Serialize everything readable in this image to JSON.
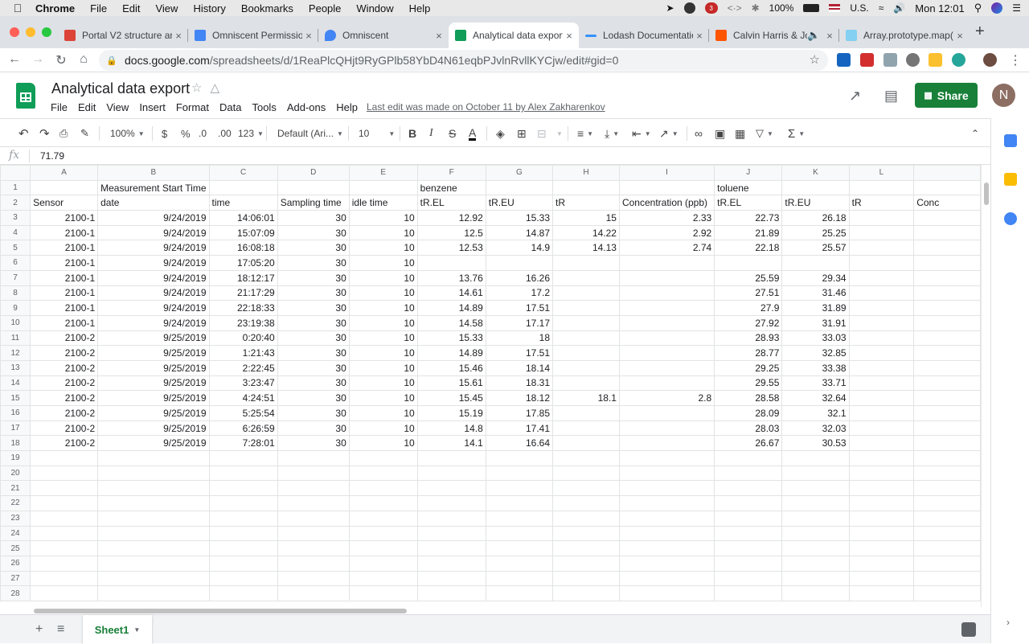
{
  "menubar": {
    "app": "Chrome",
    "items": [
      "File",
      "Edit",
      "View",
      "History",
      "Bookmarks",
      "People",
      "Window",
      "Help"
    ],
    "battery": "100%",
    "input_source": "U.S.",
    "clock": "Mon 12:01",
    "badge_count": "3"
  },
  "tabs": [
    {
      "title": "Portal V2 structure an",
      "color": "#db4437"
    },
    {
      "title": "Omniscent Permission",
      "color": "#4285f4"
    },
    {
      "title": "Omniscent",
      "color": "#4285f4"
    },
    {
      "title": "Analytical data export",
      "color": "#0f9d58"
    },
    {
      "title": "Lodash Documentation",
      "color": "#3492ff"
    },
    {
      "title": "Calvin Harris & Jo",
      "color": "#ff5500"
    },
    {
      "title": "Array.prototype.map(",
      "color": "#83d0f2"
    }
  ],
  "address": {
    "host": "docs.google.com",
    "path": "/spreadsheets/d/1ReaPlcQHjt9RyGPlb58YbD4N61eqbPJvlnRvllKYCjw/edit#gid=0"
  },
  "doc": {
    "title": "Analytical data export",
    "menu": [
      "File",
      "Edit",
      "View",
      "Insert",
      "Format",
      "Data",
      "Tools",
      "Add-ons",
      "Help"
    ],
    "last_edit": "Last edit was made on October 11 by Alex Zakharenkov",
    "share_label": "Share",
    "avatar_letter": "N"
  },
  "toolbar": {
    "zoom": "100%",
    "currency": "$",
    "percent": "%",
    "dec_decrease": ".0",
    "dec_increase": ".00",
    "format_more": "123",
    "font": "Default (Ari...",
    "font_size": "10",
    "bold": "B",
    "italic": "I",
    "strike": "S",
    "text_color": "A"
  },
  "formula_bar": {
    "fx": "fx",
    "value": "71.79"
  },
  "grid": {
    "columns": [
      "A",
      "B",
      "C",
      "D",
      "E",
      "F",
      "G",
      "H",
      "I",
      "J",
      "K",
      "L",
      ""
    ],
    "rows": [
      [
        "",
        "Measurement Start Time",
        "",
        "",
        "",
        "benzene",
        "",
        "",
        "",
        "toluene",
        "",
        "",
        ""
      ],
      [
        "Sensor",
        "date",
        "time",
        "Sampling time",
        "idle time",
        "tR.EL",
        "tR.EU",
        "tR",
        "Concentration (ppb)",
        "tR.EL",
        "tR.EU",
        "tR",
        "Conc"
      ],
      [
        "2100-1",
        "9/24/2019",
        "14:06:01",
        "30",
        "10",
        "12.92",
        "15.33",
        "15",
        "2.33",
        "22.73",
        "26.18",
        "",
        ""
      ],
      [
        "2100-1",
        "9/24/2019",
        "15:07:09",
        "30",
        "10",
        "12.5",
        "14.87",
        "14.22",
        "2.92",
        "21.89",
        "25.25",
        "",
        ""
      ],
      [
        "2100-1",
        "9/24/2019",
        "16:08:18",
        "30",
        "10",
        "12.53",
        "14.9",
        "14.13",
        "2.74",
        "22.18",
        "25.57",
        "",
        ""
      ],
      [
        "2100-1",
        "9/24/2019",
        "17:05:20",
        "30",
        "10",
        "",
        "",
        "",
        "",
        "",
        "",
        "",
        ""
      ],
      [
        "2100-1",
        "9/24/2019",
        "18:12:17",
        "30",
        "10",
        "13.76",
        "16.26",
        "",
        "",
        "25.59",
        "29.34",
        "",
        ""
      ],
      [
        "2100-1",
        "9/24/2019",
        "21:17:29",
        "30",
        "10",
        "14.61",
        "17.2",
        "",
        "",
        "27.51",
        "31.46",
        "",
        ""
      ],
      [
        "2100-1",
        "9/24/2019",
        "22:18:33",
        "30",
        "10",
        "14.89",
        "17.51",
        "",
        "",
        "27.9",
        "31.89",
        "",
        ""
      ],
      [
        "2100-1",
        "9/24/2019",
        "23:19:38",
        "30",
        "10",
        "14.58",
        "17.17",
        "",
        "",
        "27.92",
        "31.91",
        "",
        ""
      ],
      [
        "2100-2",
        "9/25/2019",
        "0:20:40",
        "30",
        "10",
        "15.33",
        "18",
        "",
        "",
        "28.93",
        "33.03",
        "",
        ""
      ],
      [
        "2100-2",
        "9/25/2019",
        "1:21:43",
        "30",
        "10",
        "14.89",
        "17.51",
        "",
        "",
        "28.77",
        "32.85",
        "",
        ""
      ],
      [
        "2100-2",
        "9/25/2019",
        "2:22:45",
        "30",
        "10",
        "15.46",
        "18.14",
        "",
        "",
        "29.25",
        "33.38",
        "",
        ""
      ],
      [
        "2100-2",
        "9/25/2019",
        "3:23:47",
        "30",
        "10",
        "15.61",
        "18.31",
        "",
        "",
        "29.55",
        "33.71",
        "",
        ""
      ],
      [
        "2100-2",
        "9/25/2019",
        "4:24:51",
        "30",
        "10",
        "15.45",
        "18.12",
        "18.1",
        "2.8",
        "28.58",
        "32.64",
        "",
        ""
      ],
      [
        "2100-2",
        "9/25/2019",
        "5:25:54",
        "30",
        "10",
        "15.19",
        "17.85",
        "",
        "",
        "28.09",
        "32.1",
        "",
        ""
      ],
      [
        "2100-2",
        "9/25/2019",
        "6:26:59",
        "30",
        "10",
        "14.8",
        "17.41",
        "",
        "",
        "28.03",
        "32.03",
        "",
        ""
      ],
      [
        "2100-2",
        "9/25/2019",
        "7:28:01",
        "30",
        "10",
        "14.1",
        "16.64",
        "",
        "",
        "26.67",
        "30.53",
        "",
        ""
      ]
    ],
    "total_rows": 28
  },
  "sheets": {
    "active": "Sheet1"
  },
  "colors": {
    "share_green": "#188038",
    "sheets_green": "#0f9d58",
    "grid_line": "#e2e3e3",
    "header_bg": "#f8f9fa"
  }
}
